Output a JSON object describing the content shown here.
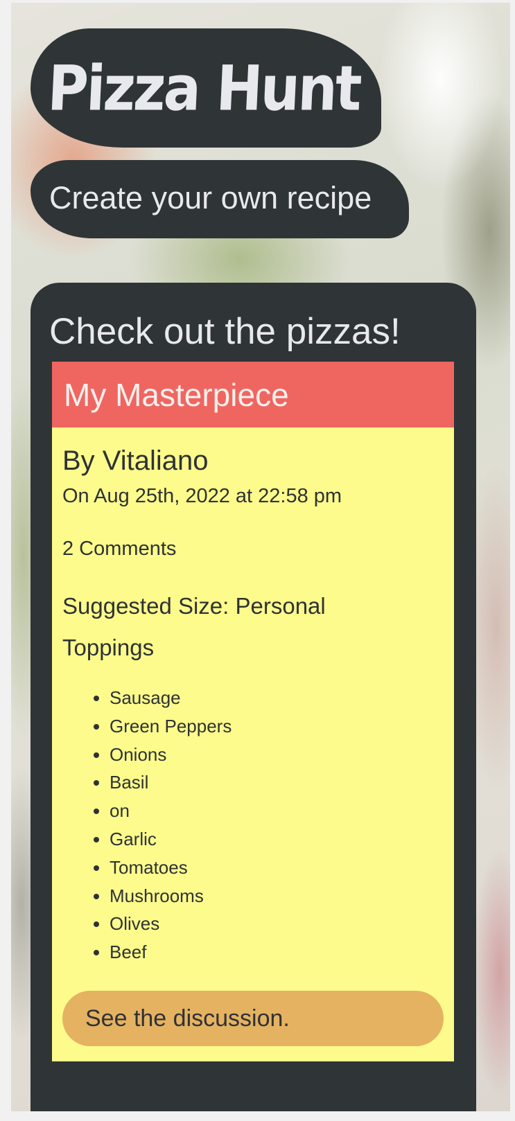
{
  "header": {
    "title": "Pizza Hunt",
    "create_link": "Create your own recipe"
  },
  "main": {
    "heading": "Check out the pizzas!"
  },
  "pizza": {
    "name": "My Masterpiece",
    "author": "By Vitaliano",
    "created": "On Aug 25th, 2022 at 22:58 pm",
    "comments": "2 Comments",
    "size": "Suggested Size: Personal",
    "toppings_label": "Toppings",
    "toppings": [
      "Sausage",
      "Green Peppers",
      "Onions",
      "Basil",
      "on",
      "Garlic",
      "Tomatoes",
      "Mushrooms",
      "Olives",
      "Beef"
    ],
    "discussion_button": "See the discussion."
  },
  "colors": {
    "dark_panel": "#2f3437",
    "card_background": "#fdfb8b",
    "card_header": "#ef6661",
    "button": "#e5b262"
  }
}
